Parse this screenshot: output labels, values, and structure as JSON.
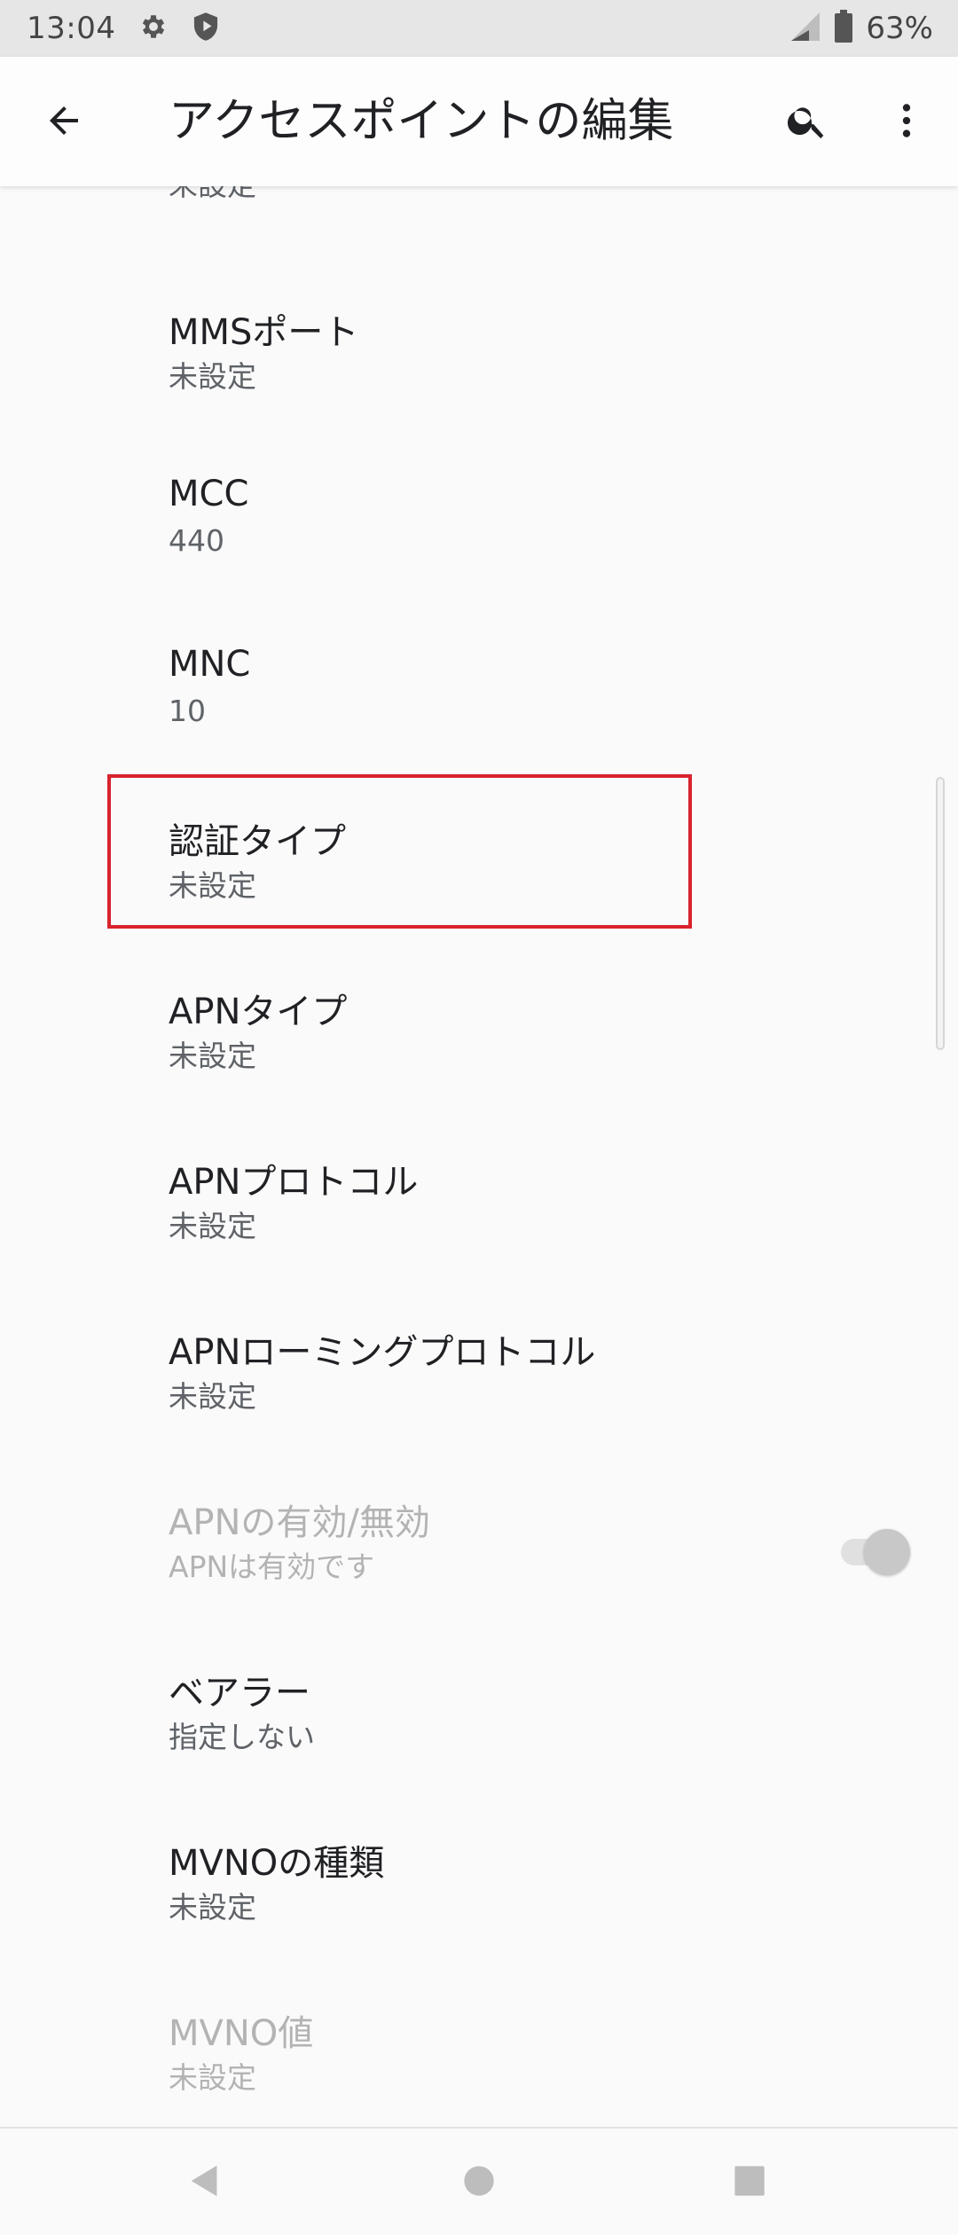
{
  "status_bar": {
    "time": "13:04",
    "left_icons": [
      "gear-icon",
      "shield-icon"
    ],
    "right_icons": [
      "signal-icon",
      "battery-icon"
    ],
    "battery": "63%"
  },
  "app_bar": {
    "title": "アクセスポイントの編集",
    "icons": [
      "back-arrow-icon",
      "search-icon",
      "more-vert-icon"
    ]
  },
  "list": {
    "cut_off_summary": "未設定",
    "items": [
      {
        "title": "MMSポート",
        "summary": "未設定",
        "enabled": true
      },
      {
        "title": "MCC",
        "summary": "440",
        "enabled": true
      },
      {
        "title": "MNC",
        "summary": "10",
        "enabled": true
      },
      {
        "title": "認証タイプ",
        "summary": "未設定",
        "enabled": true,
        "highlighted": true
      },
      {
        "title": "APNタイプ",
        "summary": "未設定",
        "enabled": true
      },
      {
        "title": "APNプロトコル",
        "summary": "未設定",
        "enabled": true
      },
      {
        "title": "APNローミングプロトコル",
        "summary": "未設定",
        "enabled": true
      },
      {
        "title": "APNの有効/無効",
        "summary": "APNは有効です",
        "enabled": false,
        "toggle_on": true
      },
      {
        "title": "ベアラー",
        "summary": "指定しない",
        "enabled": true
      },
      {
        "title": "MVNOの種類",
        "summary": "未設定",
        "enabled": true
      },
      {
        "title": "MVNO値",
        "summary": "未設定",
        "enabled": false
      }
    ]
  },
  "nav_bar": {
    "icons": [
      "nav-back-icon",
      "nav-home-icon",
      "nav-recents-icon"
    ]
  },
  "colors": {
    "highlight": "#d9232d",
    "background": "#fafafa",
    "status_bar": "#e6e6e6",
    "primary_text": "#202124",
    "secondary_text": "#5f6368",
    "disabled_text": "#b3b3b3"
  }
}
